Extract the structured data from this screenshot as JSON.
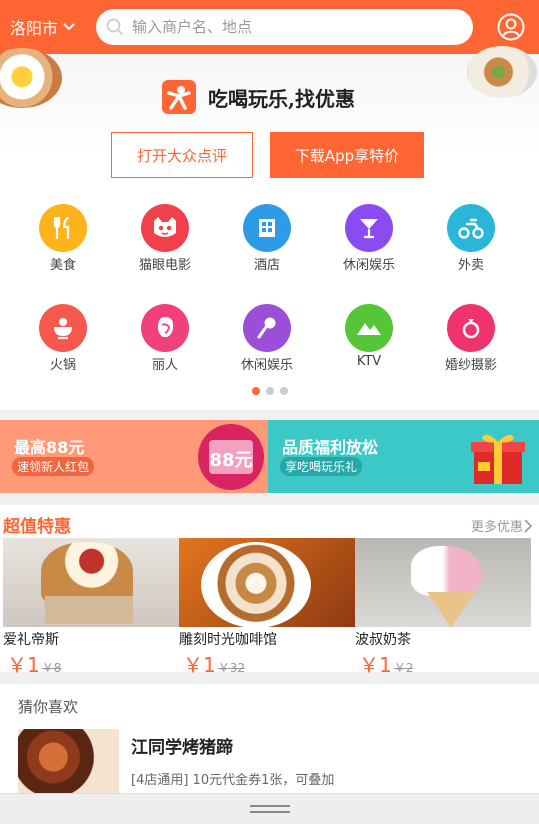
{
  "header": {
    "city": "洛阳市",
    "search_placeholder": "输入商户名、地点",
    "user_icon": "user-circle-icon",
    "accent": "#ff6633"
  },
  "hero": {
    "brand_title": "吃喝玩乐,找优惠",
    "open_button": "打开大众点评",
    "download_button": "下载App享特价"
  },
  "categories": [
    {
      "label": "美食",
      "icon": "fork-knife-icon",
      "color": "#ffb31a"
    },
    {
      "label": "猫眼电影",
      "icon": "cat-icon",
      "color": "#f0404a"
    },
    {
      "label": "酒店",
      "icon": "building-icon",
      "color": "#2f9be6"
    },
    {
      "label": "休闲娱乐",
      "icon": "cocktail-icon",
      "color": "#8a4cf0"
    },
    {
      "label": "外卖",
      "icon": "scooter-icon",
      "color": "#29b6d8"
    },
    {
      "label": "火锅",
      "icon": "hotpot-icon",
      "color": "#f5594e"
    },
    {
      "label": "丽人",
      "icon": "lady-icon",
      "color": "#f0417a"
    },
    {
      "label": "休闲娱乐",
      "icon": "microphone-icon",
      "color": "#9b4fd8"
    },
    {
      "label": "KTV",
      "icon": "mountain-icon",
      "color": "#55c638"
    },
    {
      "label": "婚纱摄影",
      "icon": "ring-icon",
      "color": "#f0326e"
    }
  ],
  "pager": {
    "pages": 3,
    "active": 0
  },
  "banners": {
    "left": {
      "title": "最高88元",
      "subtitle": "速领新人红包",
      "badge": "88元"
    },
    "right": {
      "title": "品质福利放松",
      "subtitle": "享吃喝玩乐礼"
    }
  },
  "deals": {
    "title": "超值特惠",
    "more": "更多优惠",
    "items": [
      {
        "name": "爱礼帝斯",
        "price": "￥1",
        "old_price": "￥8"
      },
      {
        "name": "雕刻时光咖啡馆",
        "price": "￥1",
        "old_price": "￥32"
      },
      {
        "name": "波叔奶茶",
        "price": "￥1",
        "old_price": "￥2"
      }
    ]
  },
  "guess": {
    "title": "猜你喜欢",
    "item": {
      "name": "江同学烤猪蹄",
      "desc": "[4店通用] 10元代金券1张，可叠加"
    }
  }
}
